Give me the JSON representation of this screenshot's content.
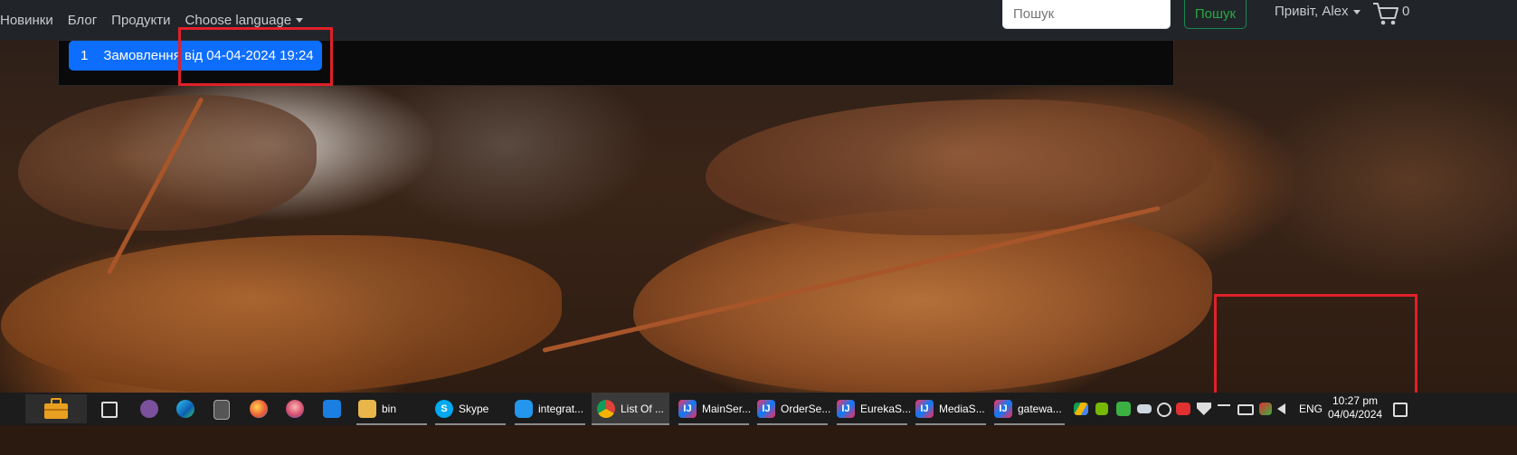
{
  "navbar": {
    "links": [
      "Новинки",
      "Блог",
      "Продукти",
      "Choose language"
    ],
    "search_placeholder": "Пошук",
    "search_button": "Пошук",
    "user_greeting": "Привіт, Alex",
    "cart_count": "0"
  },
  "orders": {
    "items": [
      {
        "number": "1",
        "label": "Замовлення від 04-04-2024 19:24"
      }
    ]
  },
  "taskbar": {
    "apps": [
      {
        "label": "bin",
        "icon": "folder-icon"
      },
      {
        "label": "Skype",
        "icon": "skype-icon"
      },
      {
        "label": "integrat...",
        "icon": "docker-icon"
      },
      {
        "label": "List Of ...",
        "icon": "chrome-icon"
      },
      {
        "label": "MainSer...",
        "icon": "intellij-icon"
      },
      {
        "label": "OrderSe...",
        "icon": "intellij-icon"
      },
      {
        "label": "EurekaS...",
        "icon": "intellij-icon"
      },
      {
        "label": "MediaS...",
        "icon": "intellij-icon"
      },
      {
        "label": "gatewa...",
        "icon": "intellij-icon"
      }
    ],
    "tray": {
      "language": "ENG"
    },
    "clock": {
      "time": "10:27 pm",
      "date": "04/04/2024"
    }
  },
  "colors": {
    "navbar_bg": "#212529",
    "primary": "#0d6efd",
    "success": "#198754",
    "highlight": "#e0202a",
    "taskbar_bg": "#1c1c1c"
  }
}
